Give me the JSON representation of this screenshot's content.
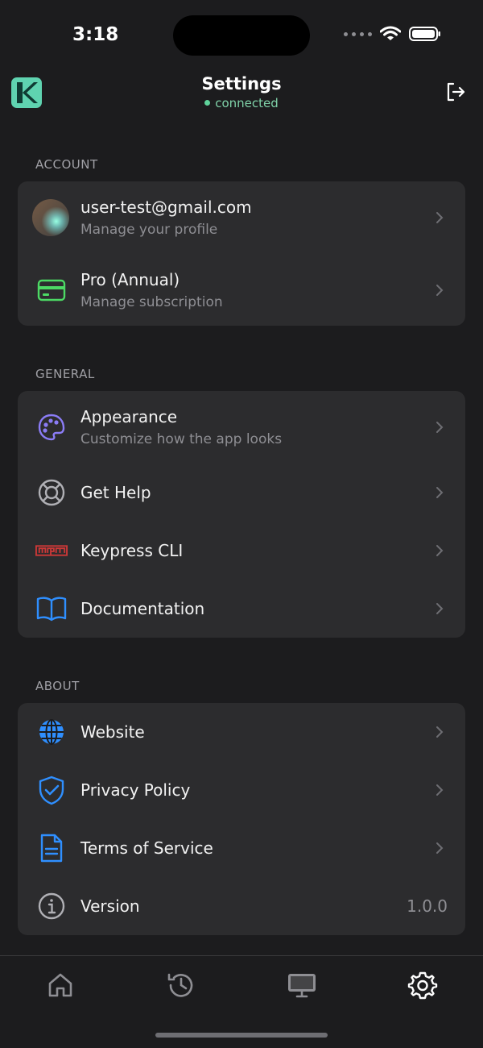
{
  "status_bar": {
    "time": "3:18"
  },
  "header": {
    "title": "Settings",
    "status": "connected"
  },
  "sections": {
    "account": {
      "label": "ACCOUNT",
      "profile": {
        "title": "user-test@gmail.com",
        "subtitle": "Manage your profile"
      },
      "subscription": {
        "title": "Pro (Annual)",
        "subtitle": "Manage subscription"
      }
    },
    "general": {
      "label": "GENERAL",
      "appearance": {
        "title": "Appearance",
        "subtitle": "Customize how the app looks"
      },
      "help": {
        "title": "Get Help"
      },
      "cli": {
        "title": "Keypress CLI"
      },
      "docs": {
        "title": "Documentation"
      }
    },
    "about": {
      "label": "ABOUT",
      "website": {
        "title": "Website"
      },
      "privacy": {
        "title": "Privacy Policy"
      },
      "terms": {
        "title": "Terms of Service"
      },
      "version": {
        "title": "Version",
        "value": "1.0.0"
      }
    }
  },
  "tabs": [
    "home-icon",
    "history-icon",
    "monitor-icon",
    "gear-icon"
  ],
  "colors": {
    "accent_green": "#5fd39b",
    "blue": "#2f8fff",
    "purple": "#8b7cf6",
    "npm_red": "#cb3837"
  }
}
